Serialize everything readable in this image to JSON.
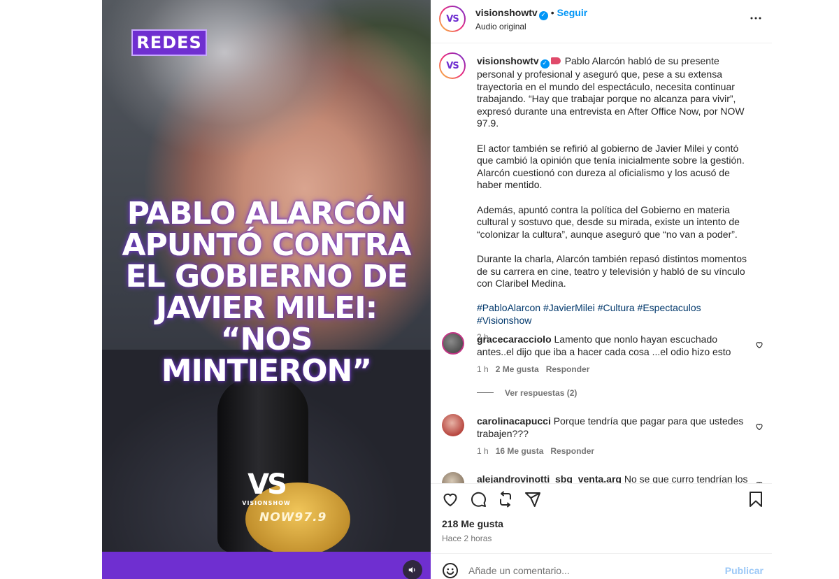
{
  "media": {
    "tag": "REDES",
    "headline": "PABLO ALARCÓN APUNTÓ CONTRA EL GOBIERNO DE JAVIER MILEI: “NOS MINTIERON”",
    "logo_vs": "VS",
    "logo_name": "VISIONSHOW",
    "mic_brand": "NOW97.9",
    "accent": "#6f2fd0"
  },
  "header": {
    "avatar": "VS",
    "username": "visionshowtv",
    "separator": "•",
    "follow": "Seguir",
    "subtitle": "Audio original",
    "more_icon": "more-horizontal-icon"
  },
  "caption": {
    "avatar": "VS",
    "username": "visionshowtv",
    "p1": "Pablo Alarcón habló de su presente personal y profesional y aseguró que, pese a su extensa trayectoria en el mundo del espectáculo, necesita continuar trabajando. “Hay que trabajar porque no alcanza para vivir”, expresó durante una entrevista en After Office Now, por NOW 97.9.",
    "p2": "El actor también se refirió al gobierno de Javier Milei y contó que cambió la opinión que tenía inicialmente sobre la gestión. Alarcón cuestionó con dureza al oficialismo y los acusó de haber mentido.",
    "p3": "Además, apuntó contra la política del Gobierno en materia cultural y sostuvo que, desde su mirada, existe un intento de “colonizar la cultura”, aunque aseguró que “no van a poder”.",
    "p4": "Durante la charla, Alarcón también repasó distintos momentos de su carrera en cine, teatro y televisión y habló de su vínculo con Claribel Medina.",
    "hashtags": "#PabloAlarcon #JavierMilei #Cultura #Espectaculos #Visionshow",
    "time": "2 h"
  },
  "comments": [
    {
      "username": "gracecaracciolo",
      "text": "Lamento que nonlo hayan escuchado antes..el dijo que iba a hacer cada cosa ...el odio hizo esto",
      "time": "1 h",
      "likes": "2 Me gusta",
      "reply": "Responder",
      "view_replies": "Ver respuestas (2)"
    },
    {
      "username": "carolinacapucci",
      "text": "Porque tendría que pagar para que ustedes trabajen???",
      "time": "1 h",
      "likes": "16 Me gusta",
      "reply": "Responder"
    },
    {
      "username": "alejandrovinotti_sbg_venta.arg",
      "text": "No se que curro tendrían los"
    }
  ],
  "actions": {
    "like_icon": "heart-icon",
    "comment_icon": "comment-icon",
    "repost_icon": "repost-icon",
    "share_icon": "share-icon",
    "save_icon": "bookmark-icon",
    "likes": "218 Me gusta",
    "ago": "Hace 2 horas"
  },
  "add_comment": {
    "placeholder": "Añade un comentario...",
    "publish": "Publicar"
  }
}
